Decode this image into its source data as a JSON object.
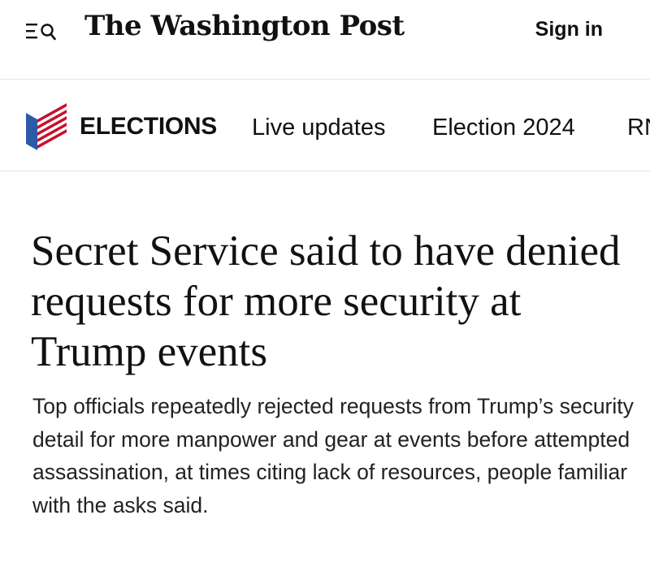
{
  "header": {
    "masthead": "The Washington Post",
    "sign_in_label": "Sign in",
    "menu_icon": "menu-search-icon"
  },
  "section_nav": {
    "section_title": "ELECTIONS",
    "section_icon": "elections-flag-icon",
    "links": [
      "Live updates",
      "Election 2024",
      "RN"
    ]
  },
  "article": {
    "headline": "Secret Service said to have denied requests for more security at Trump events",
    "dek": "Top officials repeatedly rejected requests from Trump’s security detail for more manpower and gear at events before attempted assassination, at times citing lack of resources, people familiar with the asks said."
  },
  "colors": {
    "flag_blue": "#2c5aa8",
    "flag_red": "#c8102e",
    "divider": "#e3e3e3"
  }
}
